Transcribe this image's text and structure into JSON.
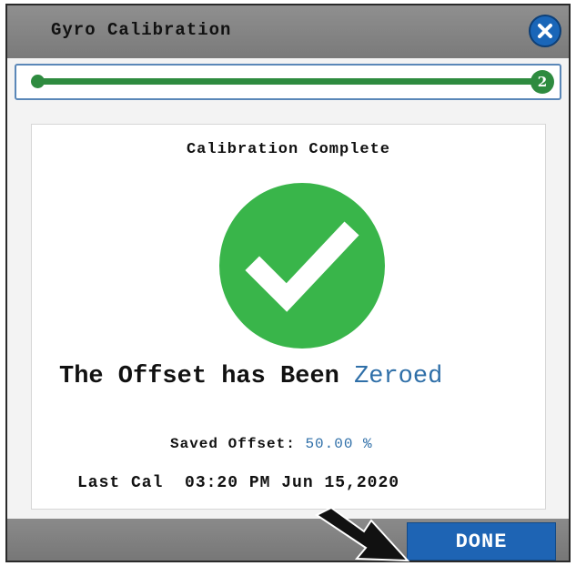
{
  "dialog": {
    "title": "Gyro Calibration",
    "close_icon": "close-x-icon"
  },
  "progress": {
    "current_step": "2",
    "fraction_complete": 1.0,
    "color": "#2e8b3f"
  },
  "result": {
    "heading": "Calibration Complete",
    "status_icon": "checkmark-circle-icon",
    "status_color": "#39b54a",
    "message_prefix": "The Offset has Been",
    "message_accent": "Zeroed",
    "saved_offset_label": "Saved Offset:",
    "saved_offset_value": "50.00 %",
    "last_cal_label": "Last Cal",
    "last_cal_time": "03:20 PM Jun 15,2020"
  },
  "footer": {
    "done_label": "DONE",
    "done_color": "#1e64b4",
    "annotation_icon": "pointer-arrow-icon"
  }
}
